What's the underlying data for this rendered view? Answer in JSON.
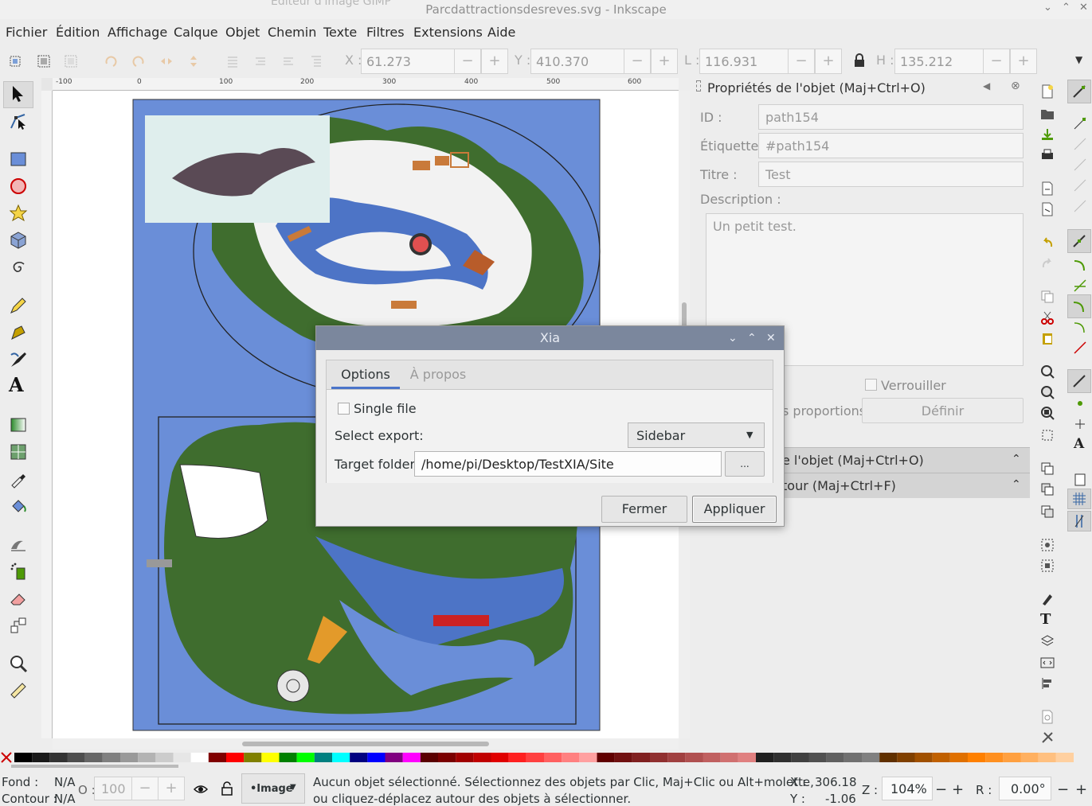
{
  "window": {
    "background_title": "Éditeur d'image GIMP",
    "title": "Parcdattractionsdesreves.svg - Inkscape"
  },
  "menu": [
    "Fichier",
    "Édition",
    "Affichage",
    "Calque",
    "Objet",
    "Chemin",
    "Texte",
    "Filtres",
    "Extensions",
    "Aide"
  ],
  "toolbar": {
    "x_label": "X :",
    "x_value": "61.273",
    "y_label": "Y :",
    "y_value": "410.370",
    "w_label": "L :",
    "w_value": "116.931",
    "h_label": "H :",
    "h_value": "135.212"
  },
  "ruler": {
    "h_ticks": [
      "-100",
      "0",
      "100",
      "200",
      "300",
      "400",
      "500",
      "600"
    ]
  },
  "object_panel": {
    "title": "Propriétés de l'objet (Maj+Ctrl+O)",
    "id_label": "ID :",
    "id_value": "path154",
    "etiquette_label": "Étiquette :",
    "etiquette_value": "#path154",
    "titre_label": "Titre :",
    "titre_value": "Test",
    "description_label": "Description :",
    "description_value": "Un petit test.",
    "verrouiller_label": "Verrouiller",
    "proportions_label": "s proportions",
    "definir_button": "Définir",
    "collapsed1": "e l'objet (Maj+Ctrl+O)",
    "collapsed2": "tour (Maj+Ctrl+F)"
  },
  "dialog": {
    "title": "Xia",
    "tab_options": "Options",
    "tab_apropos": "À propos",
    "single_file_label": "Single file",
    "select_export_label": "Select export:",
    "select_export_value": "Sidebar",
    "target_folder_label": "Target folder:",
    "target_folder_value": "/home/pi/Desktop/TestXIA/Site",
    "browse_label": "...",
    "close_button": "Fermer",
    "apply_button": "Appliquer"
  },
  "status": {
    "fond_label": "Fond :",
    "fond_value": "N/A",
    "contour_label": "Contour :",
    "contour_value": "N/A",
    "opacity_label": "O :",
    "opacity_value": "100",
    "layer": "•Image",
    "message_line1": "Aucun objet sélectionné. Sélectionnez des objets par Clic, Maj+Clic ou Alt+molette,",
    "message_line2": "ou cliquez-déplacez autour des objets à sélectionner.",
    "x_label": "X :",
    "x_value": "306.18",
    "y_label": "Y :",
    "y_value": "-1.06",
    "zoom_label": "Z :",
    "zoom_value": "104%",
    "rotation_label": "R :",
    "rotation_value": "0.00°"
  },
  "colors": {
    "dialog_title": "#7b879d",
    "map_background": "#6a8ed8",
    "accent": "#4a74c9"
  }
}
